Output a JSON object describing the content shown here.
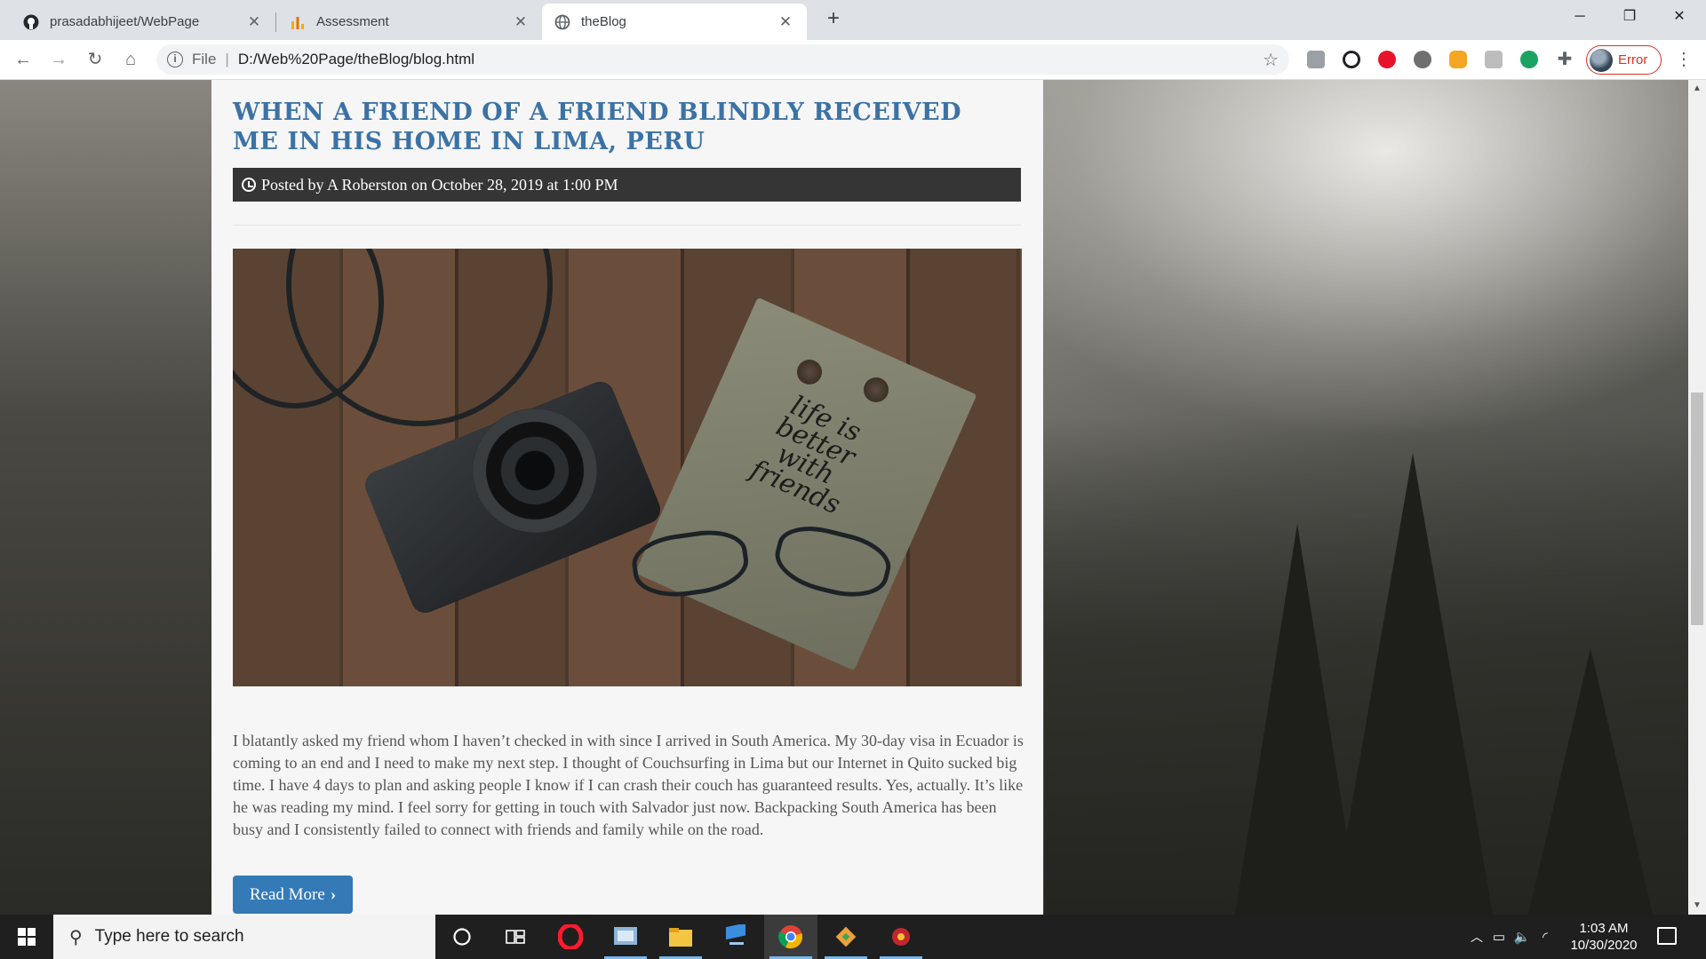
{
  "browser": {
    "tabs": [
      {
        "title": "prasadabhijeet/WebPage",
        "icon": "github-icon"
      },
      {
        "title": "Assessment",
        "icon": "analytics-icon"
      },
      {
        "title": "theBlog",
        "icon": "globe-icon",
        "active": true
      }
    ],
    "new_tab": "+",
    "address": {
      "scheme_label": "File",
      "url": "D:/Web%20Page/theBlog/blog.html"
    },
    "profile_label": "Error",
    "extensions": [
      "pdf-icon",
      "link-icon",
      "opera-icon",
      "circle-icon",
      "badge-icon",
      "translate-icon",
      "dot-icon",
      "puzzle-icon"
    ]
  },
  "post": {
    "title": "WHEN A FRIEND OF A FRIEND BLINDLY RECEIVED ME IN HIS HOME IN LIMA, PERU",
    "meta": "Posted by A Roberston on October 28, 2019 at 1:00 PM",
    "image_text": "life is better with friends",
    "body": "I blatantly asked my friend whom I haven’t checked in with since I arrived in South America. My 30-day visa in Ecuador is coming to an end and I need to make my next step. I thought of Couchsurfing in Lima but our Internet in Quito sucked big time. I have 4 days to plan and asking people I know if I can crash their couch has guaranteed results. Yes, actually. It’s like he was reading my mind. I feel sorry for getting in touch with Salvador just now. Backpacking South America has been busy and I consistently failed to connect with friends and family while on the road.",
    "read_more": "Read More"
  },
  "taskbar": {
    "search_placeholder": "Type here to search",
    "apps": [
      "cortana-icon",
      "task-view-icon",
      "opera-icon",
      "snipping-icon",
      "file-explorer-icon",
      "network-icon",
      "chrome-icon",
      "git-icon",
      "app-icon"
    ],
    "time": "1:03 AM",
    "date": "10/30/2020"
  },
  "colors": {
    "title_blue": "#3c72a5",
    "meta_bar": "#353535",
    "button_blue": "#337ab7",
    "profile_error": "#d93025"
  }
}
